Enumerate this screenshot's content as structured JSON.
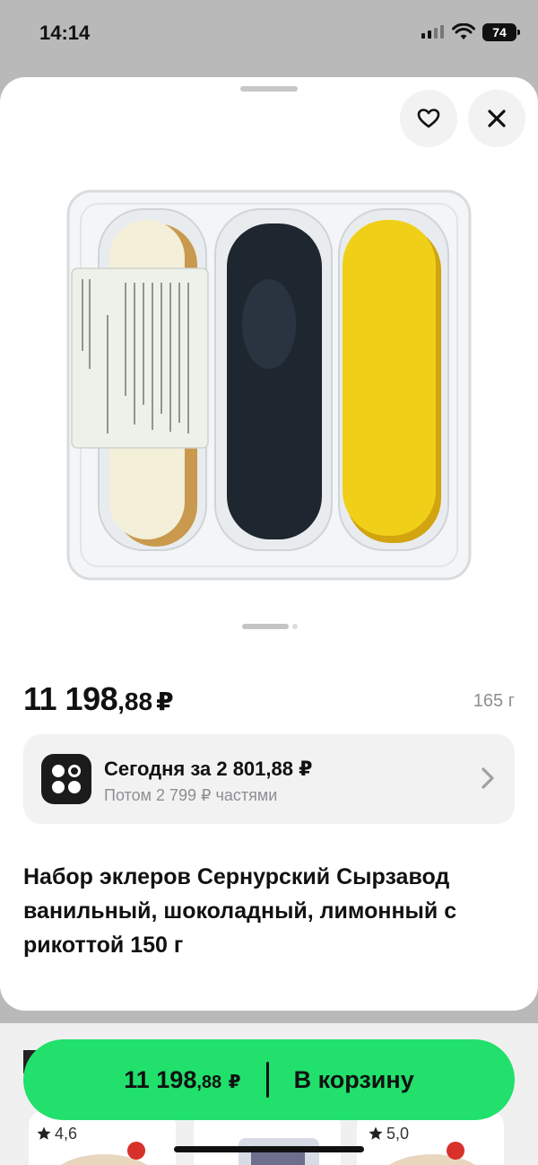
{
  "status_bar": {
    "time": "14:14",
    "battery": "74"
  },
  "product": {
    "price_main": "11 198",
    "price_cents": ",88",
    "currency": "₽",
    "weight": "165 г",
    "title": "Набор эклеров Сернурский Сырзавод ванильный, шоколадный, лимонный с рикоттой 150 г",
    "image_pages": 2,
    "image_page_active": 1
  },
  "installments": {
    "line1": "Сегодня за 2 801,88 ₽",
    "line2": "Потом 2 799 ₽ частями"
  },
  "cart_button": {
    "price_main": "11 198",
    "price_cents": ",88",
    "currency": "₽",
    "label": "В корзину"
  },
  "recommendations": [
    {
      "rating": "4,6"
    },
    {
      "rating": ""
    },
    {
      "rating": "5,0"
    }
  ],
  "colors": {
    "accent": "#21e06b",
    "sheet_bg": "#ffffff",
    "backdrop": "#b9b9b9"
  }
}
